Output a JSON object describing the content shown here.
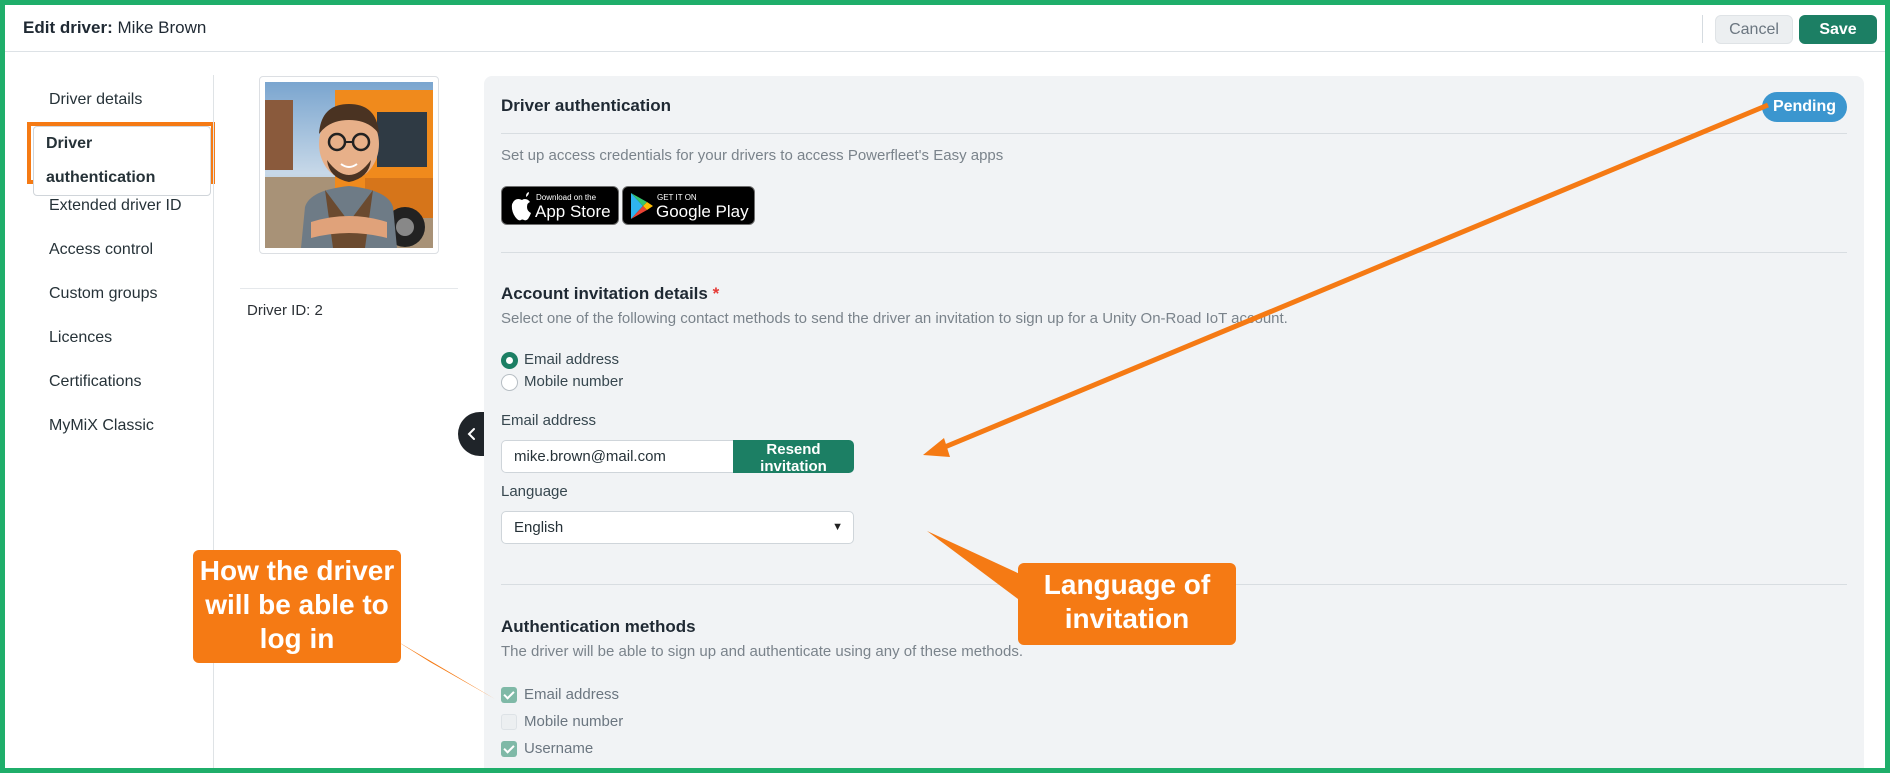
{
  "header": {
    "title_prefix": "Edit driver",
    "title_sep": ":",
    "driver_name": "Mike Brown",
    "cancel_label": "Cancel",
    "save_label": "Save"
  },
  "nav": {
    "items": [
      {
        "label": "Driver details"
      },
      {
        "label": "Driver authentication"
      },
      {
        "label": "Extended driver ID"
      },
      {
        "label": "Access control"
      },
      {
        "label": "Custom groups"
      },
      {
        "label": "Licences"
      },
      {
        "label": "Certifications"
      },
      {
        "label": "MyMiX Classic"
      }
    ]
  },
  "profile": {
    "driver_id": "Driver ID: 2"
  },
  "panel": {
    "title": "Driver authentication",
    "status_badge": "Pending",
    "subtitle": "Set up access credentials for your drivers to access Powerfleet's Easy apps",
    "app_store": {
      "small": "Download on the",
      "big": "App Store"
    },
    "google_play": {
      "small": "GET IT ON",
      "big": "Google Play"
    },
    "invitation": {
      "title": "Account invitation details",
      "required_mark": "*",
      "subtitle": "Select one of the following contact methods to send the driver an invitation to sign up for a Unity On-Road IoT account.",
      "options": [
        "Email address",
        "Mobile number"
      ],
      "email_label": "Email address",
      "email_value": "mike.brown@mail.com",
      "resend_label": "Resend invitation",
      "language_label": "Language",
      "language_value": "English"
    },
    "auth_methods": {
      "title": "Authentication methods",
      "subtitle": "The driver will be able to sign up and authenticate using any of these methods.",
      "options": [
        {
          "label": "Email address",
          "checked": true
        },
        {
          "label": "Mobile number",
          "checked": false
        },
        {
          "label": "Username",
          "checked": true
        }
      ]
    }
  },
  "callouts": {
    "login": "How the driver will be able to log in",
    "language": "Language of invitation"
  },
  "colors": {
    "accent": "#1c7f64",
    "callout": "#f57a14",
    "badge": "#3b96cf",
    "frame": "#1fae6a"
  }
}
